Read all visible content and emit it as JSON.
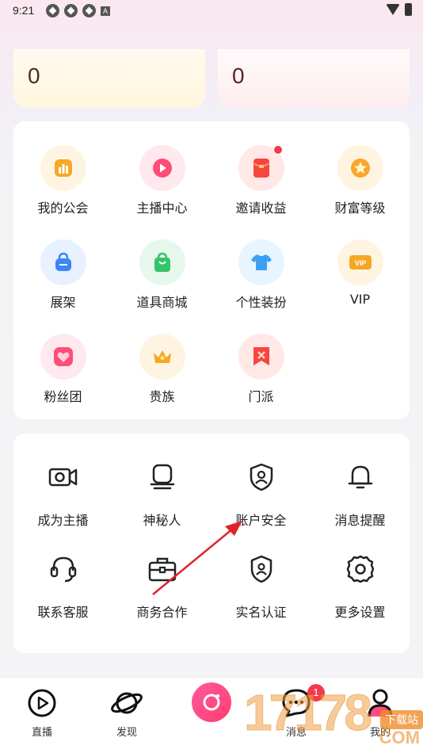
{
  "status_bar": {
    "time": "9:21",
    "notification_icons": [
      "app-icon",
      "app-icon",
      "app-icon"
    ],
    "a_icon": "A"
  },
  "stats": [
    {
      "value": "0"
    },
    {
      "value": "0"
    }
  ],
  "features": [
    {
      "label": "我的公会",
      "icon": "chart-icon",
      "color": "#f7a826"
    },
    {
      "label": "主播中心",
      "icon": "play-icon",
      "color": "#ff4d79"
    },
    {
      "label": "邀请收益",
      "icon": "red-envelope-icon",
      "color": "#f6463f",
      "has_dot": true
    },
    {
      "label": "财富等级",
      "icon": "star-icon",
      "color": "#f8a72a"
    },
    {
      "label": "展架",
      "icon": "bag-icon",
      "color": "#3c86f5"
    },
    {
      "label": "道具商城",
      "icon": "shop-bag-icon",
      "color": "#33c56a"
    },
    {
      "label": "个性装扮",
      "icon": "tshirt-icon",
      "color": "#3ca1f5"
    },
    {
      "label": "VIP",
      "icon": "vip-icon",
      "color": "#f5a623",
      "badge_text": "VIP"
    },
    {
      "label": "粉丝团",
      "icon": "heart-icon",
      "color": "#ff4d79"
    },
    {
      "label": "贵族",
      "icon": "crown-icon",
      "color": "#f5a623"
    },
    {
      "label": "门派",
      "icon": "banner-icon",
      "color": "#f6463f"
    }
  ],
  "services": [
    {
      "label": "成为主播",
      "icon": "camera-icon"
    },
    {
      "label": "神秘人",
      "icon": "mystery-person-icon"
    },
    {
      "label": "账户安全",
      "icon": "shield-icon"
    },
    {
      "label": "消息提醒",
      "icon": "bell-icon"
    },
    {
      "label": "联系客服",
      "icon": "headset-icon"
    },
    {
      "label": "商务合作",
      "icon": "briefcase-icon"
    },
    {
      "label": "实名认证",
      "icon": "id-shield-icon"
    },
    {
      "label": "更多设置",
      "icon": "gear-icon"
    }
  ],
  "tab_bar": {
    "tabs": [
      {
        "label": "直播",
        "icon": "play-circle-icon"
      },
      {
        "label": "发现",
        "icon": "planet-icon"
      },
      {
        "label": "",
        "icon": "camera-center-icon"
      },
      {
        "label": "消息",
        "icon": "chat-bubble-icon",
        "badge": "1"
      },
      {
        "label": "我的",
        "icon": "user-icon"
      }
    ]
  },
  "watermark": {
    "main": "17178",
    "sub": "下载站",
    "domain": "COM"
  },
  "colors": {
    "accent": "#ff3d6e",
    "annotation_arrow": "#e0242b"
  }
}
